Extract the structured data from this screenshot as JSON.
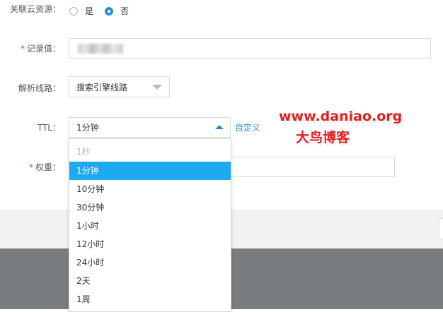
{
  "form": {
    "link_cloud": {
      "label": "关联云资源：",
      "options": [
        {
          "label": "是",
          "checked": false
        },
        {
          "label": "否",
          "checked": true
        }
      ]
    },
    "record_value": {
      "required_mark": "*",
      "label": "记录值："
    },
    "line": {
      "label": "解析线路：",
      "value": "搜索引擎线路"
    },
    "ttl": {
      "label": "TTL：",
      "value": "1分钟",
      "custom_link": "自定义",
      "options": [
        {
          "label": "1秒",
          "state": "disabled"
        },
        {
          "label": "1分钟",
          "state": "selected"
        },
        {
          "label": "10分钟",
          "state": "normal"
        },
        {
          "label": "30分钟",
          "state": "normal"
        },
        {
          "label": "1小时",
          "state": "normal"
        },
        {
          "label": "12小时",
          "state": "normal"
        },
        {
          "label": "24小时",
          "state": "normal"
        },
        {
          "label": "2天",
          "state": "normal"
        },
        {
          "label": "1周",
          "state": "normal"
        }
      ]
    },
    "weight": {
      "required_mark": "*",
      "label": "权重："
    }
  },
  "watermark": {
    "line1": "www.daniao.org",
    "line2": "大鸟博客"
  },
  "colors": {
    "accent": "#2a8fd4",
    "selected_option_bg": "#1eaaf1",
    "required": "#e4393c",
    "watermark": "#e02020",
    "footer_band": "#f2f2f2",
    "dark_band": "#7a7d80"
  }
}
